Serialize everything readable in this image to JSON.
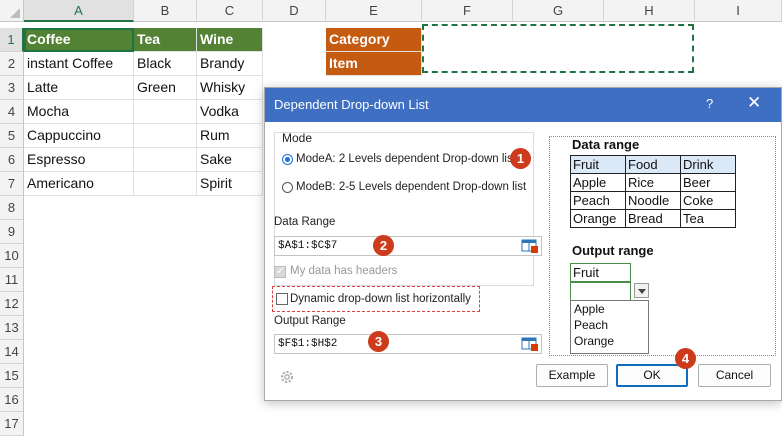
{
  "sheet": {
    "columns": [
      "A",
      "B",
      "C",
      "D",
      "E",
      "F",
      "G",
      "H",
      "I"
    ],
    "rows": [
      "1",
      "2",
      "3",
      "4",
      "5",
      "6",
      "7",
      "8",
      "9",
      "10",
      "11",
      "12",
      "13",
      "14",
      "15",
      "16",
      "17"
    ],
    "cells": {
      "A1": "Coffee",
      "B1": "Tea",
      "C1": "Wine",
      "A2": "instant Coffee",
      "B2": "Black",
      "C2": "Brandy",
      "A3": "Latte",
      "B3": "Green",
      "C3": "Whisky",
      "A4": "Mocha",
      "C4": "Vodka",
      "A5": "Cappuccino",
      "C5": "Rum",
      "A6": "Espresso",
      "C6": "Sake",
      "A7": "Americano",
      "C7": "Spirit",
      "E1": "Category",
      "E2": "Item"
    },
    "colors": {
      "header_green": "#548235",
      "orange": "#c55a11"
    }
  },
  "dialog": {
    "title": "Dependent Drop-down List",
    "help": "?",
    "close": "✕",
    "mode_label": "Mode",
    "mode_a": "ModeA: 2 Levels dependent Drop-down list",
    "mode_b": "ModeB: 2-5 Levels dependent Drop-down list",
    "data_range_label": "Data Range",
    "data_range_value": "$A$1:$C$7",
    "headers_label": "My data has headers",
    "horizontal_label": "Dynamic drop-down list horizontally",
    "output_range_label": "Output Range",
    "output_range_value": "$F$1:$H$2",
    "badges": [
      "1",
      "2",
      "3",
      "4"
    ],
    "preview": {
      "data_range_title": "Data range",
      "table": [
        [
          "Fruit",
          "Food",
          "Drink"
        ],
        [
          "Apple",
          "Rice",
          "Beer"
        ],
        [
          "Peach",
          "Noodle",
          "Coke"
        ],
        [
          "Orange",
          "Bread",
          "Tea"
        ]
      ],
      "output_range_title": "Output range",
      "output_value": "Fruit",
      "dropdown_items": [
        "Apple",
        "Peach",
        "Orange"
      ]
    },
    "buttons": {
      "example": "Example",
      "ok": "OK",
      "cancel": "Cancel"
    }
  }
}
